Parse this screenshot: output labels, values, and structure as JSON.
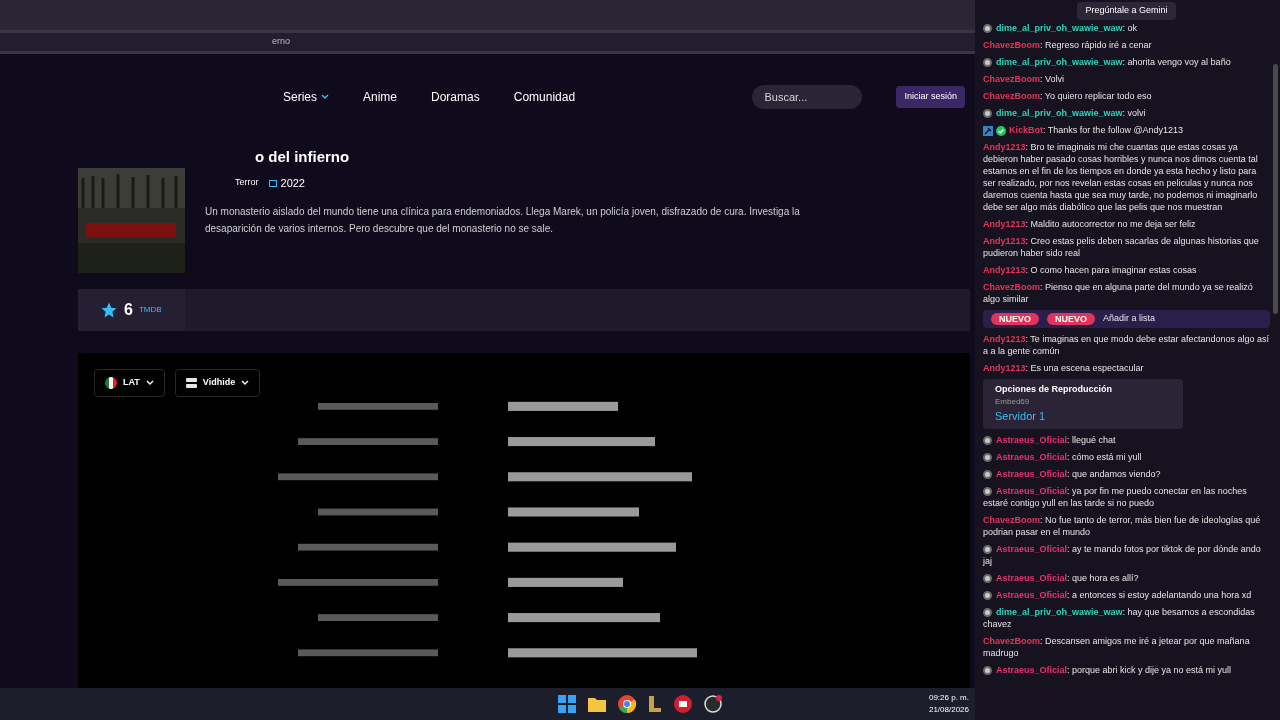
{
  "breadcrumb": "erno",
  "nav": [
    {
      "label": "Series",
      "has_menu": true
    },
    {
      "label": "Anime",
      "has_menu": false
    },
    {
      "label": "Doramas",
      "has_menu": false
    },
    {
      "label": "Comunidad",
      "has_menu": false
    }
  ],
  "header_actions": {
    "search_placeholder": "Buscar...",
    "login": "Iniciar sesión"
  },
  "movie": {
    "title": "o del infierno",
    "genre": "Terror",
    "year": "2022",
    "synopsis": "Un monasterio aislado del mundo tiene una clínica para endemoniados. Llega Marek, un policía joven, disfrazado de cura. Investiga la desaparición de varios internos. Pero descubre que del monasterio no se sale."
  },
  "rating": {
    "score": "6",
    "source": "TMDB"
  },
  "player": {
    "language": "LAT",
    "server": "Vidhide"
  },
  "browser_popup": {
    "label": "Pregúntale a Gemini"
  },
  "chat": [
    {
      "kind": "message",
      "user": "dime_al_priv_oh_wawie_waw",
      "color": "#2dd4bf",
      "subscriber": true,
      "text": ": ok"
    },
    {
      "kind": "message",
      "user": "ChavezBoom",
      "color": "#e0355b",
      "text": ": Regreso rápido iré a cenar"
    },
    {
      "kind": "message",
      "user": "dime_al_priv_oh_wawie_waw",
      "color": "#2dd4bf",
      "subscriber": true,
      "text": ": ahorita vengo voy al baño"
    },
    {
      "kind": "message",
      "user": "ChavezBoom",
      "color": "#e0355b",
      "text": ": Volvi"
    },
    {
      "kind": "message",
      "user": "ChavezBoom",
      "color": "#e0355b",
      "text": ": Yo quiero replicar todo eso"
    },
    {
      "kind": "message",
      "user": "dime_al_priv_oh_wawie_waw",
      "color": "#2dd4bf",
      "subscriber": true,
      "text": ": volvi"
    },
    {
      "kind": "message",
      "user": "KickBot",
      "color": "#e0355b",
      "bot": true,
      "verified": true,
      "text": ": Thanks for the follow @Andy1213"
    },
    {
      "kind": "message",
      "user": "Andy1213",
      "color": "#e0355b",
      "text": ": Bro te imaginais mi che cuantas que estas cosas ya debieron haber pasado cosas horribles y nunca nos dimos cuenta tal estamos en el fin de los tiempos en donde ya esta hecho y listo para ser realizado, por nos revelan estas cosas en peliculas y nunca nos daremos cuenta hasta que sea muy tarde, no podemos ni imaginarlo debe ser algo más diabólico que las pelis que nos muestran"
    },
    {
      "kind": "message",
      "user": "Andy1213",
      "color": "#e0355b",
      "text": ": Maldito autocorrector no me deja ser feliz"
    },
    {
      "kind": "message",
      "user": "Andy1213",
      "color": "#e0355b",
      "text": ": Creo estas pelis deben sacarlas de algunas historias que pudieron haber sido real"
    },
    {
      "kind": "message",
      "user": "Andy1213",
      "color": "#e0355b",
      "text": ": O como hacen para imaginar estas cosas"
    },
    {
      "kind": "message",
      "user": "ChavezBoom",
      "color": "#e0355b",
      "text": ": Pienso que en alguna parte del mundo ya se realizó algo similar"
    },
    {
      "kind": "overlay",
      "tags": [
        "NUEVO",
        "NUEVO"
      ],
      "text": "Añadir a lista"
    },
    {
      "kind": "message",
      "user": "Andy1213",
      "color": "#e0355b",
      "text": ": Te imaginas en que modo debe estar afectandonos algo así a a la gente común"
    },
    {
      "kind": "message",
      "user": "Andy1213",
      "color": "#e0355b",
      "text": ": Es una escena espectacular"
    },
    {
      "kind": "panel",
      "title": "Opciones de Reproducción",
      "subtitle": "Embed69",
      "text": "Servidor 1"
    },
    {
      "kind": "message",
      "user": "Astraeus_Oficial",
      "color": "#e6336e",
      "subscriber": true,
      "text": ": llegué chat"
    },
    {
      "kind": "message",
      "user": "Astraeus_Oficial",
      "color": "#e6336e",
      "subscriber": true,
      "text": ": cómo está mi yull"
    },
    {
      "kind": "message",
      "user": "Astraeus_Oficial",
      "color": "#e6336e",
      "subscriber": true,
      "text": ": que andamos viendo?"
    },
    {
      "kind": "message",
      "user": "Astraeus_Oficial",
      "color": "#e6336e",
      "subscriber": true,
      "text": ": ya por fin me puedo conectar en las noches estaré contigo yull en las tarde si no puedo"
    },
    {
      "kind": "message",
      "user": "ChavezBoom",
      "color": "#e0355b",
      "text": ": No fue tanto de terror, más bien fue de ideologías qué podrian pasar en el mundo"
    },
    {
      "kind": "message",
      "user": "Astraeus_Oficial",
      "color": "#e6336e",
      "subscriber": true,
      "text": ": ay te mando fotos por tiktok de por dónde ando jaj"
    },
    {
      "kind": "message",
      "user": "Astraeus_Oficial",
      "color": "#e6336e",
      "subscriber": true,
      "text": ": que hora es allí?"
    },
    {
      "kind": "message",
      "user": "Astraeus_Oficial",
      "color": "#e6336e",
      "subscriber": true,
      "text": ": a entonces si estoy adelantando una hora xd"
    },
    {
      "kind": "message",
      "user": "dime_al_priv_oh_wawie_waw",
      "color": "#2dd4bf",
      "subscriber": true,
      "text": ": hay que besarnos a escondidas chavez"
    },
    {
      "kind": "message",
      "user": "ChavezBoom",
      "color": "#e0355b",
      "text": ": Descansen amigos me iré a jetear por que mañana madrugo"
    },
    {
      "kind": "message",
      "user": "Astraeus_Oficial",
      "color": "#e6336e",
      "subscriber": true,
      "text": ": porque abri kick y dije ya no está mi yull"
    }
  ],
  "taskbar": {
    "time": "09:26 p. m.",
    "date": "21/08/2026"
  }
}
